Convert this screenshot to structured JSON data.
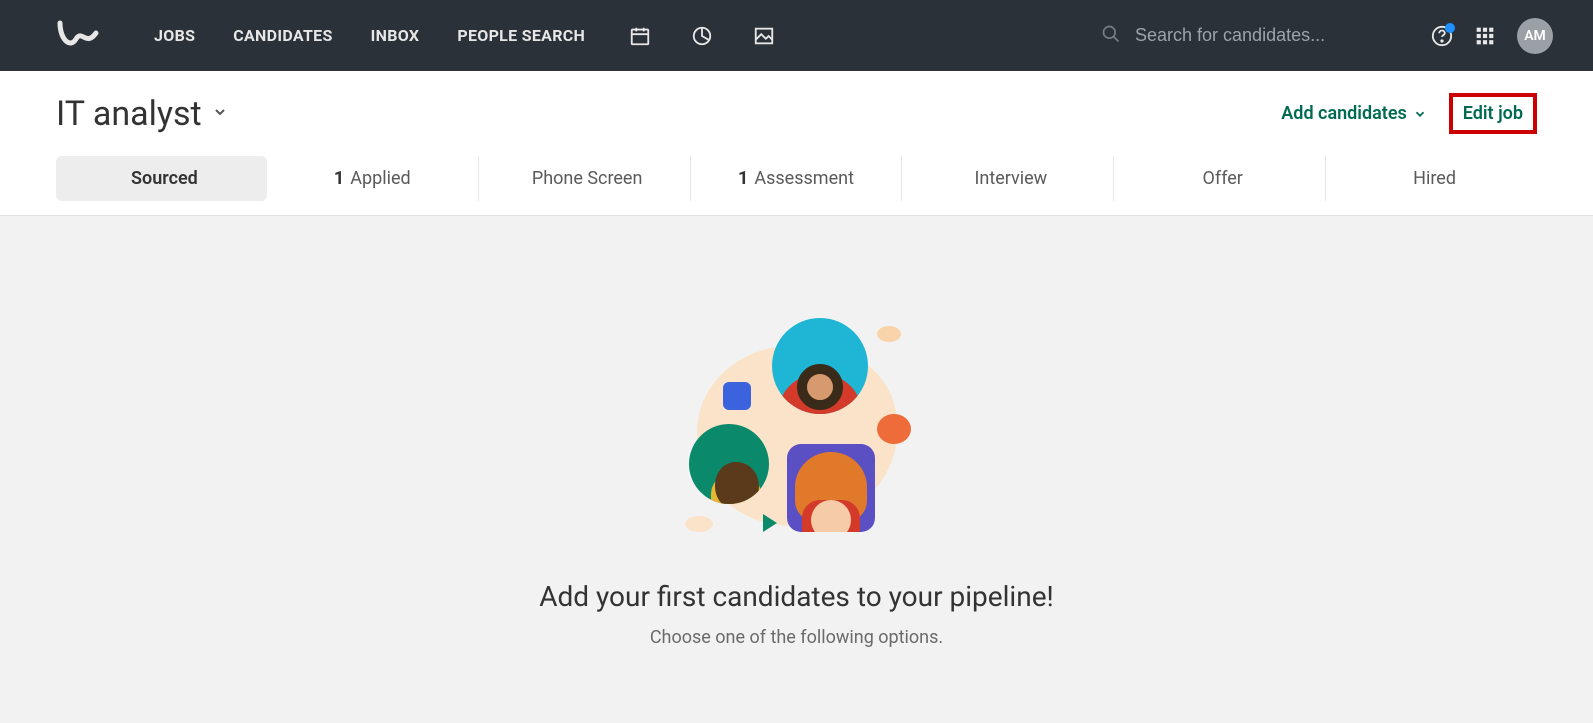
{
  "nav": {
    "links": [
      "JOBS",
      "CANDIDATES",
      "INBOX",
      "PEOPLE SEARCH"
    ]
  },
  "search": {
    "placeholder": "Search for candidates..."
  },
  "avatar": {
    "initials": "AM"
  },
  "job": {
    "title": "IT analyst"
  },
  "actions": {
    "add_candidates": "Add candidates",
    "edit_job": "Edit job"
  },
  "stages": [
    {
      "count": "",
      "label": "Sourced",
      "active": true
    },
    {
      "count": "1",
      "label": "Applied",
      "active": false
    },
    {
      "count": "",
      "label": "Phone Screen",
      "active": false
    },
    {
      "count": "1",
      "label": "Assessment",
      "active": false
    },
    {
      "count": "",
      "label": "Interview",
      "active": false
    },
    {
      "count": "",
      "label": "Offer",
      "active": false
    },
    {
      "count": "",
      "label": "Hired",
      "active": false
    }
  ],
  "empty": {
    "title": "Add your first candidates to your pipeline!",
    "subtitle": "Choose one of the following options."
  }
}
